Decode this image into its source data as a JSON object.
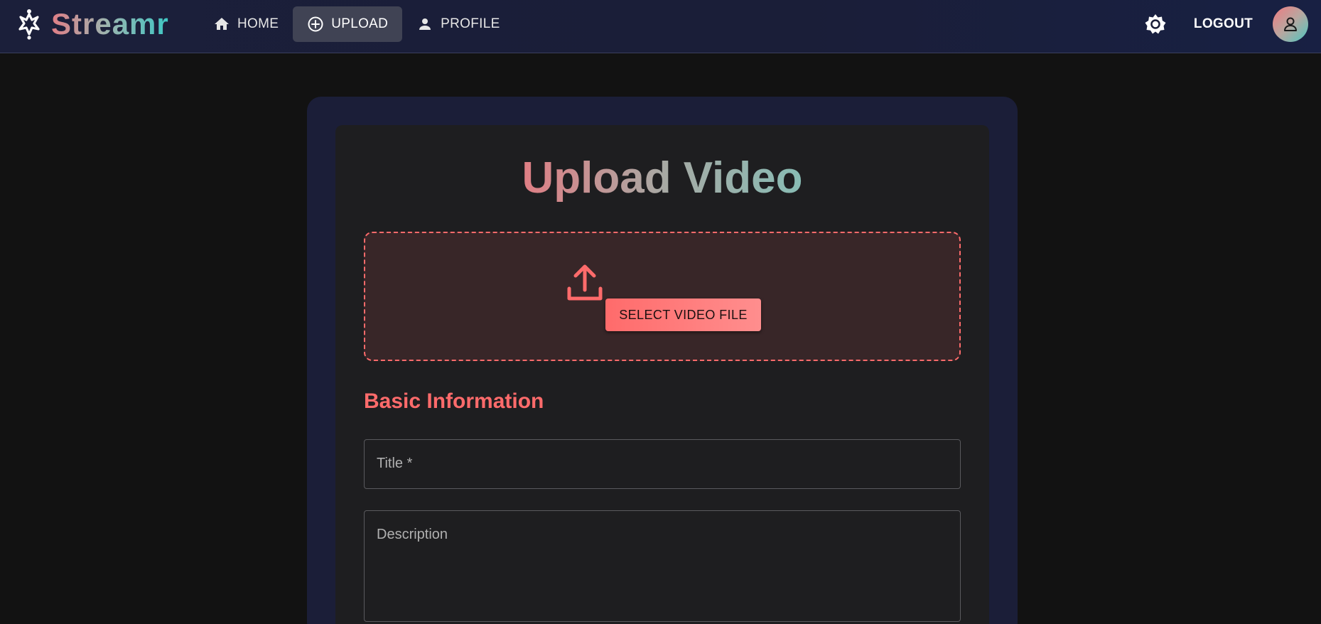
{
  "brand": {
    "name": "Streamr",
    "icon": "star-figure-icon"
  },
  "nav": {
    "items": [
      {
        "label": "HOME",
        "icon": "home-icon",
        "active": false
      },
      {
        "label": "UPLOAD",
        "icon": "add-circle-icon",
        "active": true
      },
      {
        "label": "PROFILE",
        "icon": "person-icon",
        "active": false
      }
    ],
    "theme_icon": "brightness-icon",
    "logout_label": "LOGOUT",
    "avatar_icon": "user-avatar-icon"
  },
  "main": {
    "title": "Upload Video",
    "dropzone": {
      "icon": "upload-icon",
      "button_label": "SELECT VIDEO FILE"
    },
    "section_title": "Basic Information",
    "fields": {
      "title_label": "Title *",
      "description_label": "Description"
    }
  },
  "colors": {
    "accent": "#ff6b6b",
    "navbar_bg": "#1b1f3a",
    "page_bg": "#121212",
    "card_bg": "#1e1e20",
    "dropzone_bg": "#382628",
    "brand_gradient_start": "#e07e86",
    "brand_gradient_end": "#3ec7c4"
  }
}
